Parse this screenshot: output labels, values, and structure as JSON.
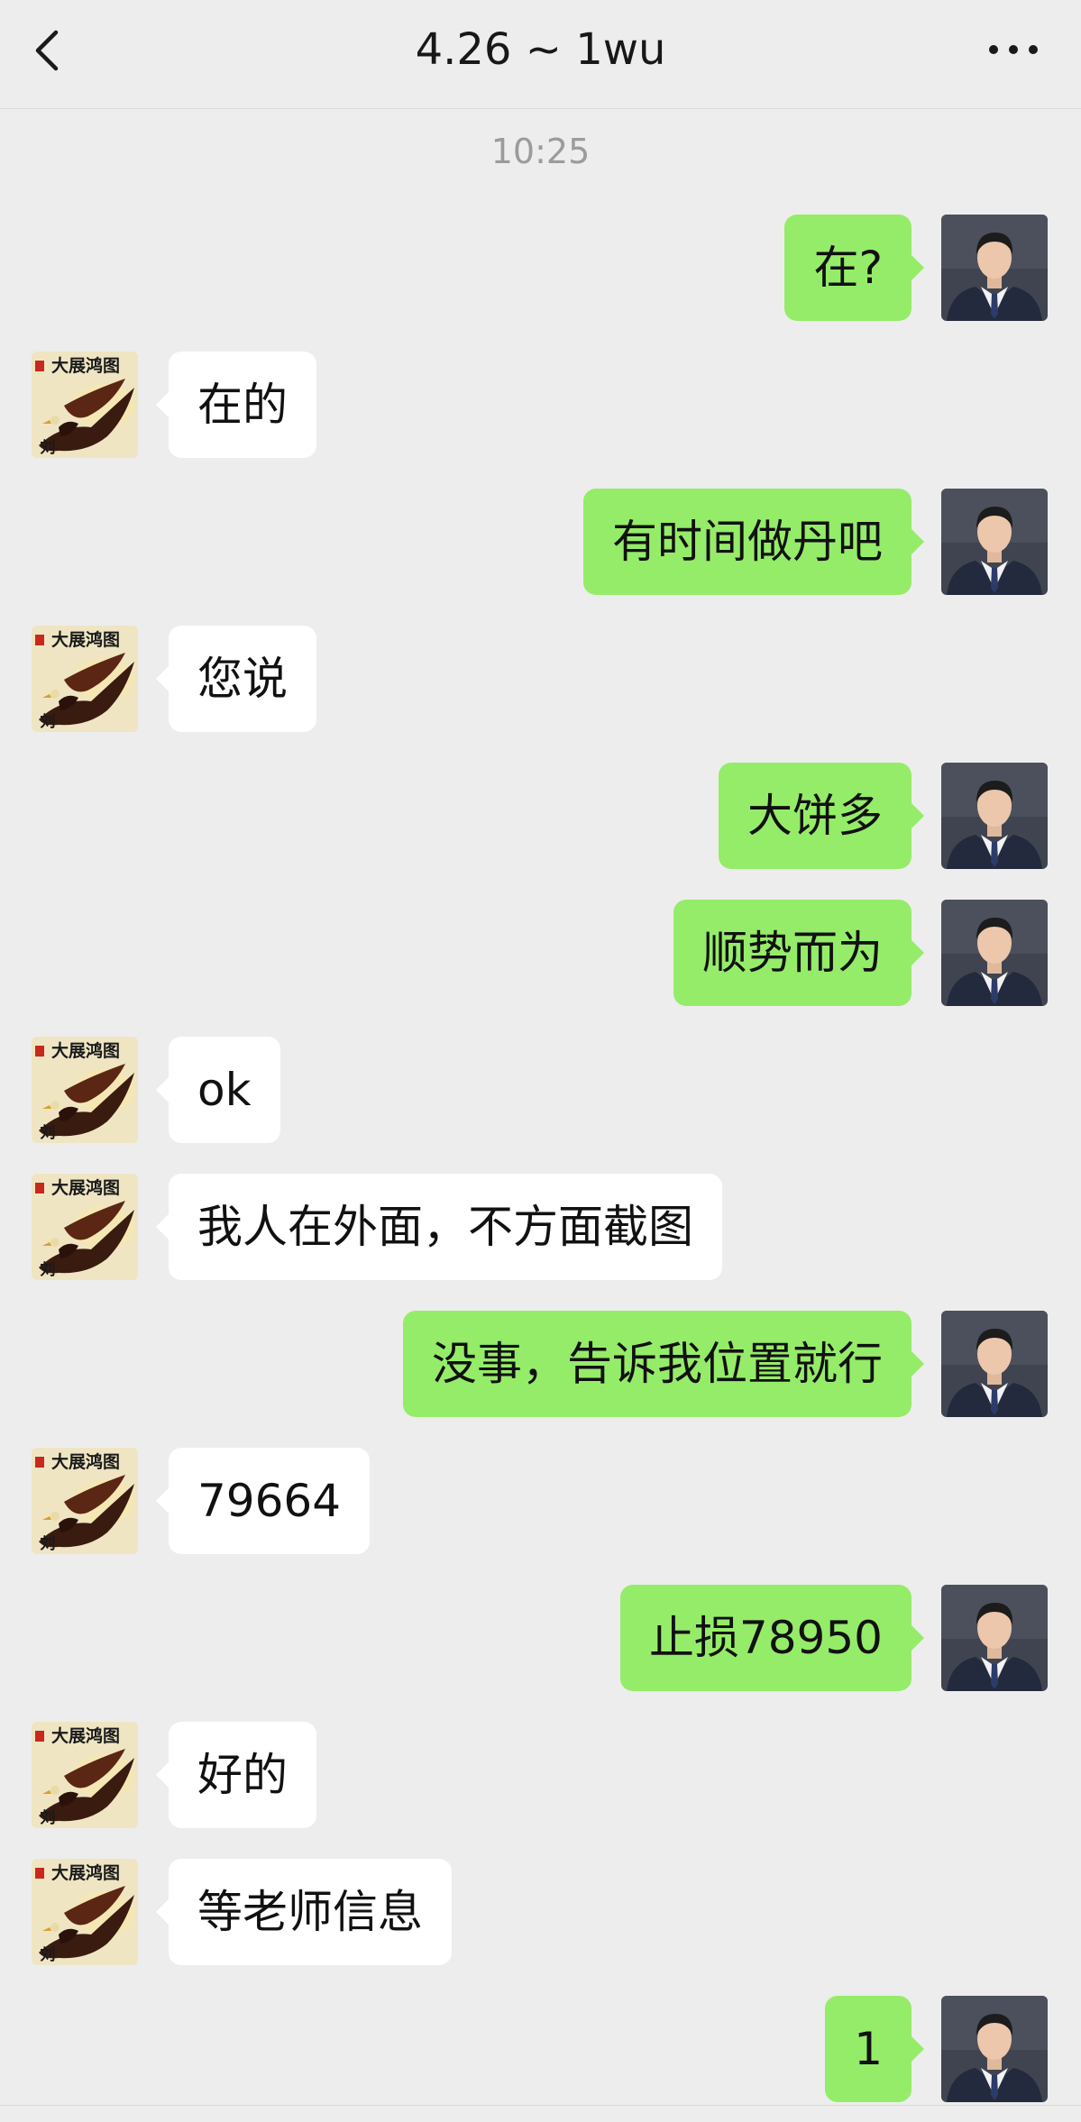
{
  "header": {
    "title": "4.26 ~ 1wu"
  },
  "timestamp": "10:25",
  "messages": [
    {
      "side": "out",
      "text": "在?"
    },
    {
      "side": "in",
      "text": "在的"
    },
    {
      "side": "out",
      "text": "有时间做丹吧"
    },
    {
      "side": "in",
      "text": "您说"
    },
    {
      "side": "out",
      "text": "大饼多"
    },
    {
      "side": "out",
      "text": "顺势而为"
    },
    {
      "side": "in",
      "text": "ok"
    },
    {
      "side": "in",
      "text": "我人在外面，不方面截图"
    },
    {
      "side": "out",
      "text": "没事，告诉我位置就行"
    },
    {
      "side": "in",
      "text": "79664"
    },
    {
      "side": "out",
      "text": "止损78950"
    },
    {
      "side": "in",
      "text": "好的"
    },
    {
      "side": "in",
      "text": "等老师信息"
    },
    {
      "side": "out",
      "text": "1"
    }
  ],
  "contact_avatar": {
    "banner_text": "大展鸿图",
    "signature": "刘"
  },
  "colors": {
    "background": "#ededed",
    "outgoing_bubble": "#95ec69",
    "incoming_bubble": "#ffffff"
  },
  "icons": {
    "back": "chevron-left-icon",
    "more": "more-dots-icon"
  }
}
